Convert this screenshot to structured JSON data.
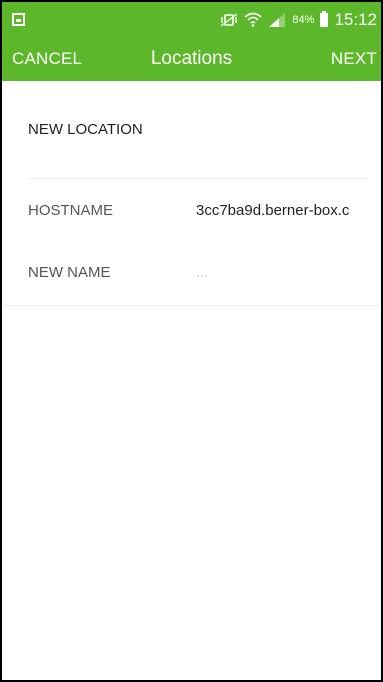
{
  "status_bar": {
    "left_icon": "gallery-icon",
    "battery_percent": "84%",
    "time": "15:12",
    "icons": [
      "mute-vibrate-icon",
      "wifi-icon",
      "signal-icon",
      "battery-icon"
    ]
  },
  "toolbar": {
    "cancel_label": "CANCEL",
    "title": "Locations",
    "next_label": "NEXT"
  },
  "form": {
    "section_title": "NEW LOCATION",
    "hostname": {
      "label": "HOSTNAME",
      "value": "3cc7ba9d.berner-box.c"
    },
    "new_name": {
      "label": "NEW NAME",
      "placeholder": "...",
      "value": ""
    }
  },
  "colors": {
    "accent": "#5cb82a",
    "background": "#ffffff"
  }
}
